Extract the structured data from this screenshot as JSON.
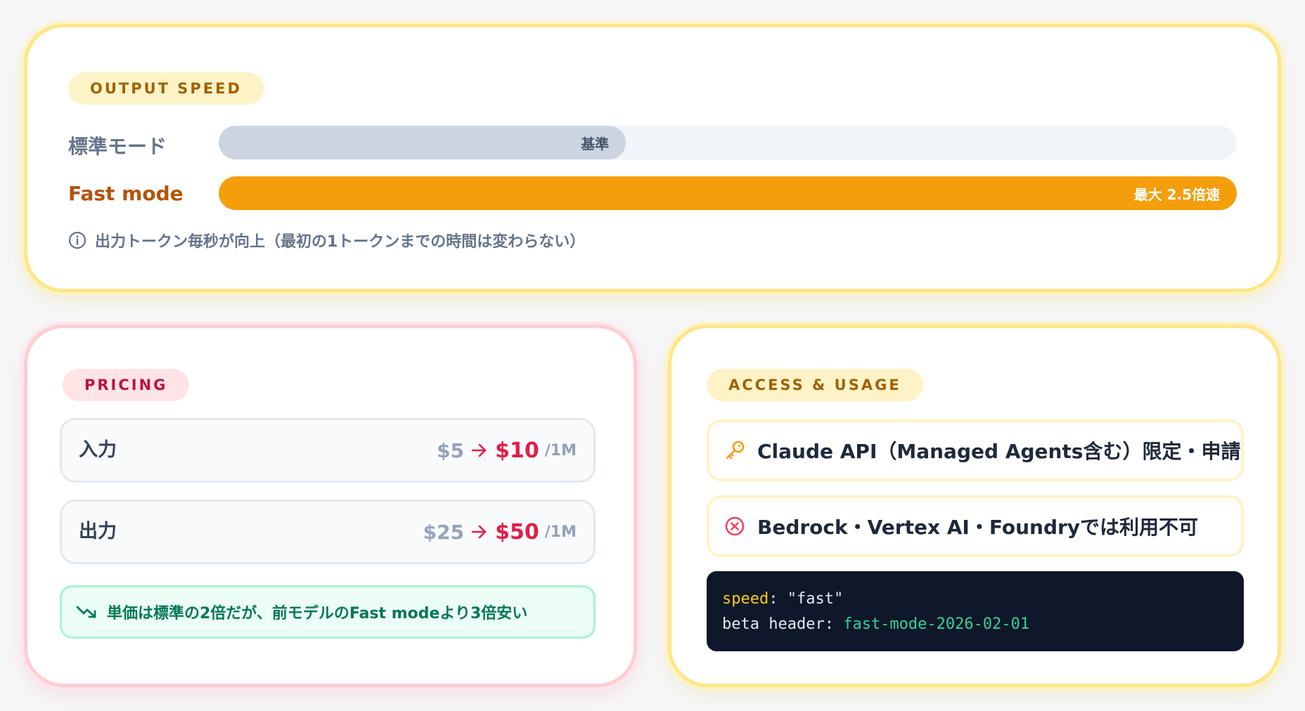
{
  "speed": {
    "pill": "OUTPUT SPEED",
    "standard": {
      "label": "標準モード",
      "bar_text": "基準",
      "level": 0.4
    },
    "fast": {
      "label": "Fast mode",
      "bar_text": "最大 2.5倍速",
      "level": 1.0
    },
    "note": "出力トークン毎秒が向上（最初の1トークンまでの時間は変わらない）",
    "icon": "info-icon"
  },
  "pricing": {
    "pill": "PRICING",
    "rows": [
      {
        "label": "入力",
        "old": "$5",
        "new": "$10",
        "unit": "/1M"
      },
      {
        "label": "出力",
        "old": "$25",
        "new": "$50",
        "unit": "/1M"
      }
    ],
    "note": "単価は標準の2倍だが、前モデルのFast modeより3倍安い",
    "note_icon": "trending-down-icon",
    "arrow_icon": "arrow-right-icon"
  },
  "access": {
    "pill": "ACCESS & USAGE",
    "items": [
      {
        "text": "Claude API（Managed Agents含む）限定・申請制",
        "icon": "key-icon"
      },
      {
        "text": "Bedrock・Vertex AI・Foundryでは利用不可",
        "icon": "x-circle-icon"
      }
    ],
    "code": {
      "line1_key": "speed",
      "line1_sep": ": ",
      "line1_value": "\"fast\"",
      "line2_key": "beta header",
      "line2_sep": ": ",
      "line2_value": "fast-mode-2026-02-01"
    }
  },
  "colors": {
    "accent_amber": "#f59e0b",
    "accent_rose": "#e11d48",
    "accent_green": "#047857"
  }
}
